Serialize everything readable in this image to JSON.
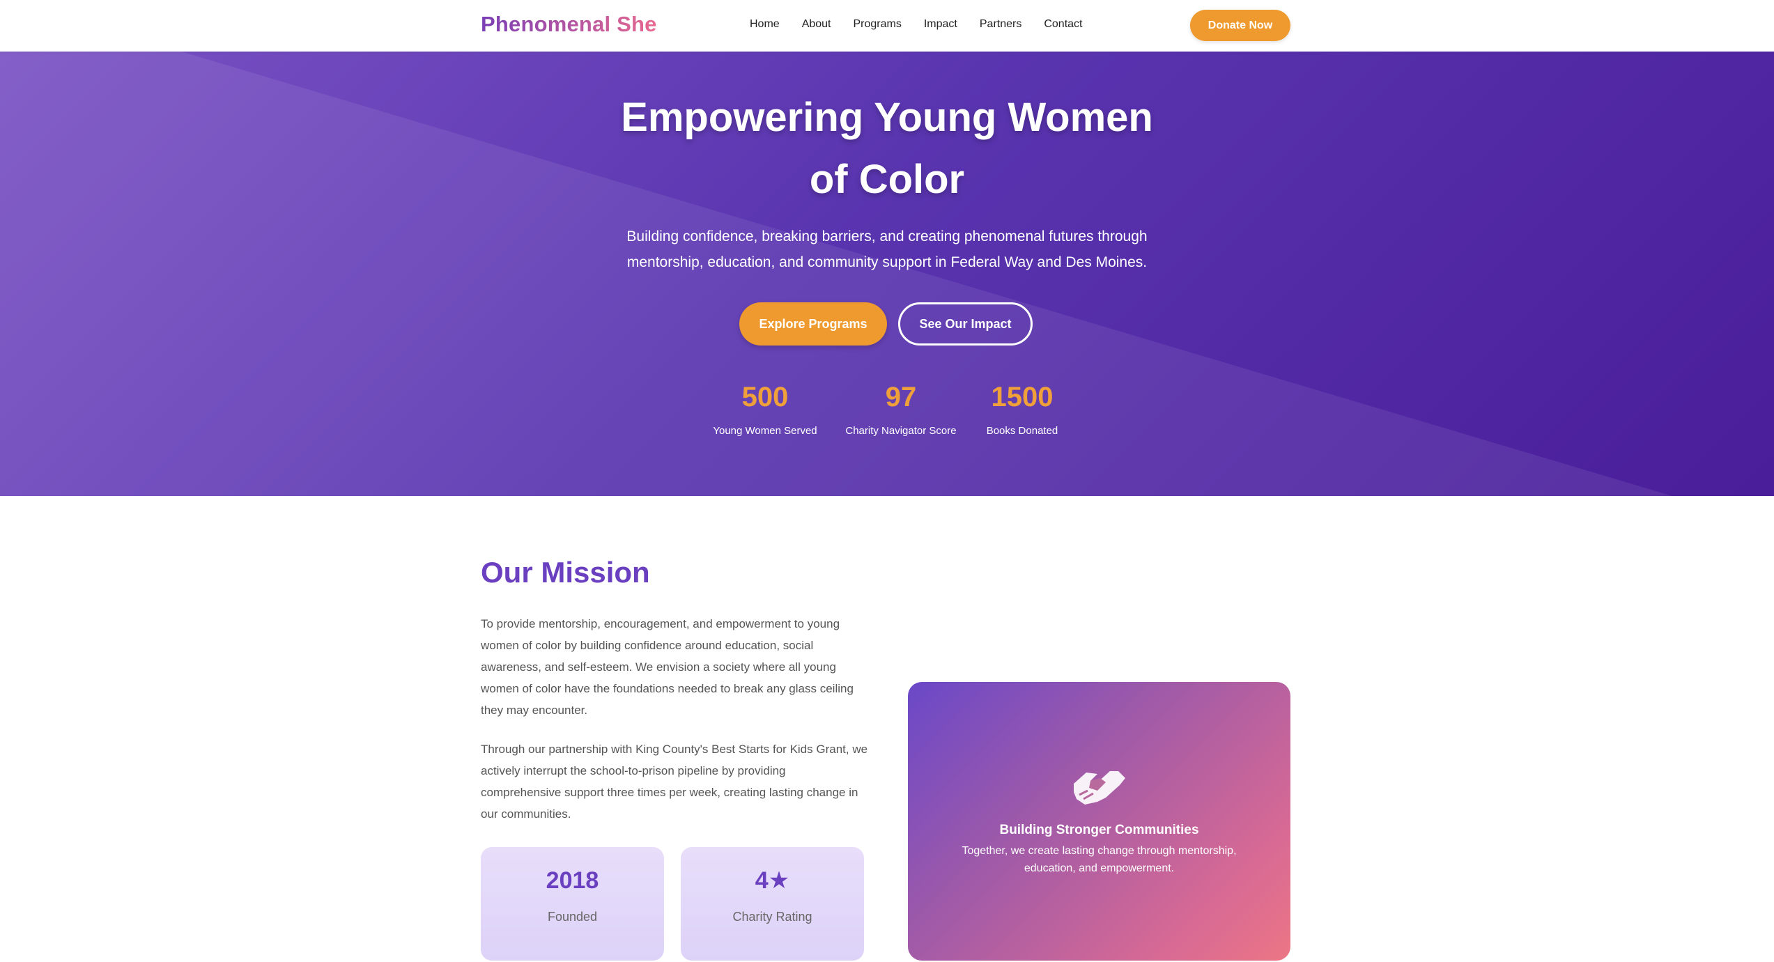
{
  "nav": {
    "brand": "Phenomenal She",
    "links": [
      "Home",
      "About",
      "Programs",
      "Impact",
      "Partners",
      "Contact"
    ],
    "donate_label": "Donate Now"
  },
  "hero": {
    "title_line1": "Empowering Young Women",
    "title_line2": "of Color",
    "subtitle": "Building confidence, breaking barriers, and creating phenomenal futures through mentorship, education, and community support in Federal Way and Des Moines.",
    "explore_label": "Explore Programs",
    "impact_label": "See Our Impact",
    "stats": [
      {
        "value": "500",
        "label": "Young Women Served"
      },
      {
        "value": "97",
        "label": "Charity Navigator Score"
      },
      {
        "value": "1500",
        "label": "Books Donated"
      }
    ]
  },
  "mission": {
    "title": "Our Mission",
    "paragraph1": "To provide mentorship, encouragement, and empowerment to young women of color by building confidence around education, social awareness, and self-esteem. We envision a society where all young women of color have the foundations needed to break any glass ceiling they may encounter.",
    "paragraph2": "Through our partnership with King County's Best Starts for Kids Grant, we actively interrupt the school-to-prison pipeline by providing comprehensive support three times per week, creating lasting change in our communities.",
    "cards": [
      {
        "value": "2018",
        "label": "Founded"
      },
      {
        "value": "4★",
        "label": "Charity Rating"
      }
    ],
    "feature": {
      "icon": "handshake-icon",
      "title": "Building Stronger Communities",
      "description": "Together, we create lasting change through mentorship, education, and empowerment."
    }
  },
  "colors": {
    "brand_purple": "#6a3fc0",
    "accent_orange": "#ef9a2e",
    "hero_gradient_start": "#7a52c4",
    "hero_gradient_end": "#4a1d9a",
    "card_bg": "#e8defa",
    "feature_gradient_end": "#ec7684"
  }
}
